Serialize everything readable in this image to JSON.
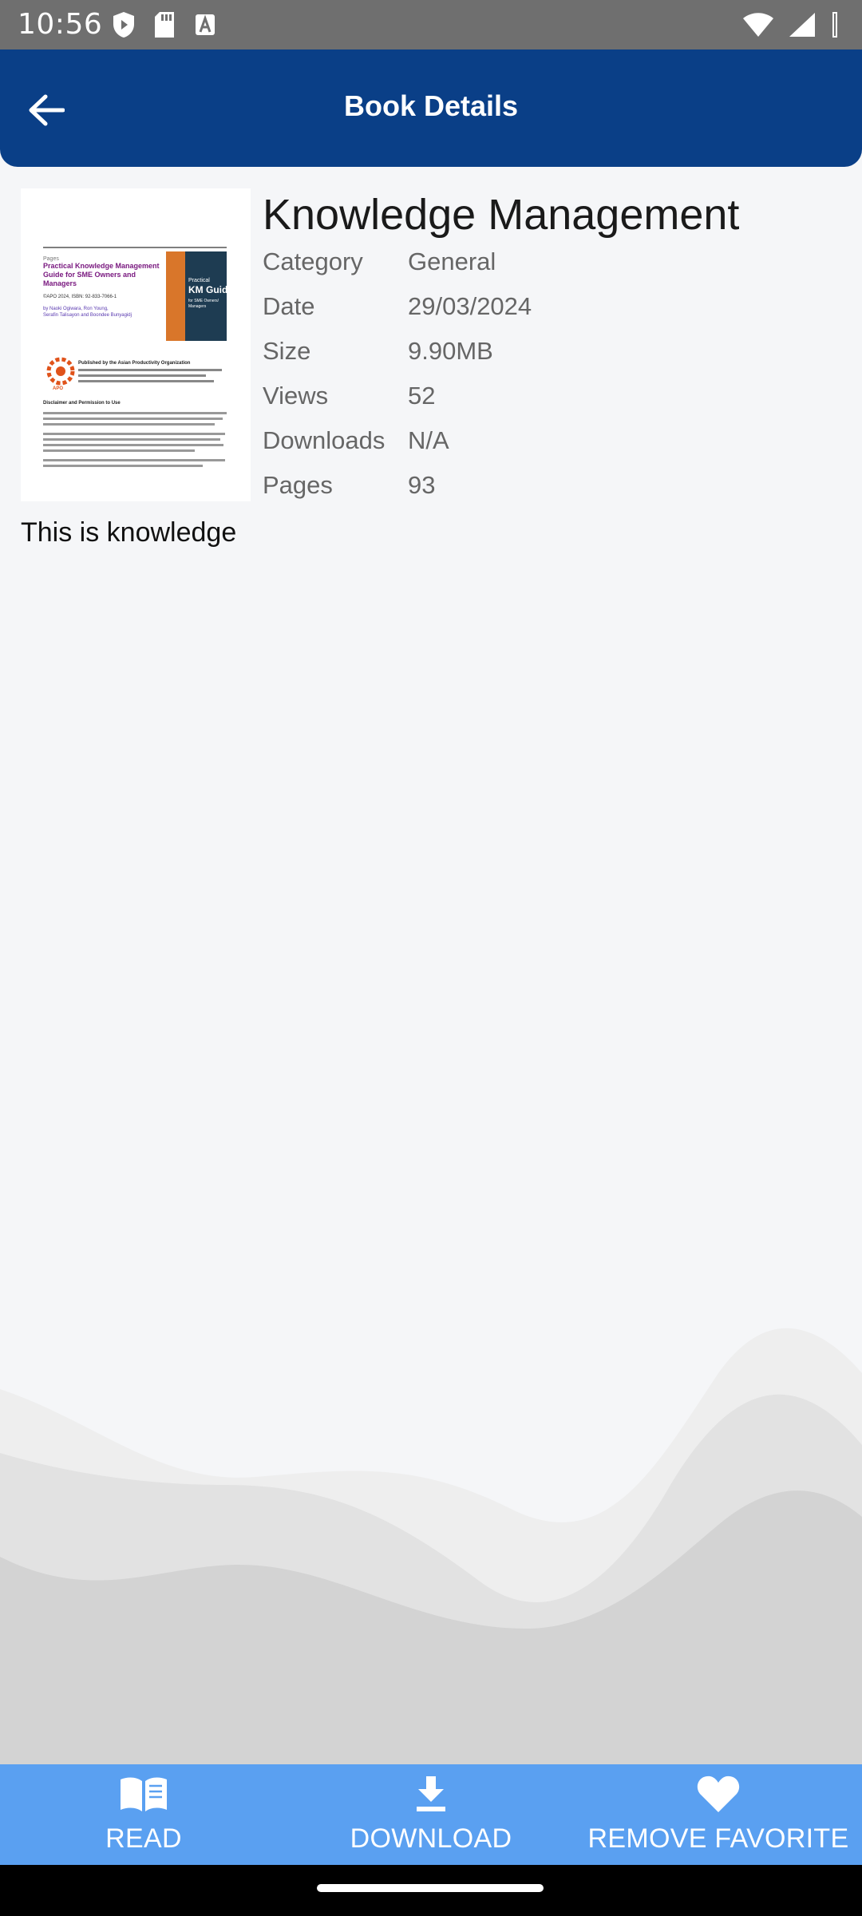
{
  "status_bar": {
    "time": "10:56"
  },
  "app_bar": {
    "title": "Book Details"
  },
  "book": {
    "title": "Knowledge Management",
    "details": [
      {
        "label": "Category",
        "value": "General"
      },
      {
        "label": "Date",
        "value": "29/03/2024"
      },
      {
        "label": "Size",
        "value": "9.90MB"
      },
      {
        "label": "Views",
        "value": "52"
      },
      {
        "label": "Downloads",
        "value": "N/A"
      },
      {
        "label": "Pages",
        "value": "93"
      }
    ],
    "description": "This is knowledge"
  },
  "cover_page": {
    "series": "Pages",
    "headline": "Practical Knowledge Management Guide for SME Owners and Managers",
    "isbn": "©APO 2024, ISBN: 92-833-7066-1",
    "authors": "by Naoki Ogiwara, Ron Young, Serafin Talisayon and Boondee Bunyagidj",
    "publisher": "Published by the Asian Productivity Organization",
    "disclaimer_heading": "Disclaimer and Permission to Use",
    "side_cover_kicker": "Practical",
    "side_cover_title": "KM Guide",
    "side_cover_sub": "for SME Owners/Managers",
    "logo_text": "APO"
  },
  "bottom_bar": {
    "read_label": "READ",
    "download_label": "DOWNLOAD",
    "remove_favorite_label": "REMOVE FAVORITE"
  },
  "colors": {
    "app_bar": "#0a3f87",
    "bottom_bar": "#5aa0f1",
    "status_bar": "#6f6f6f",
    "background": "#f5f6f8"
  },
  "icons": {
    "back": "arrow-left-icon",
    "read": "open-book-icon",
    "download": "download-icon",
    "remove_favorite": "heart-icon"
  }
}
